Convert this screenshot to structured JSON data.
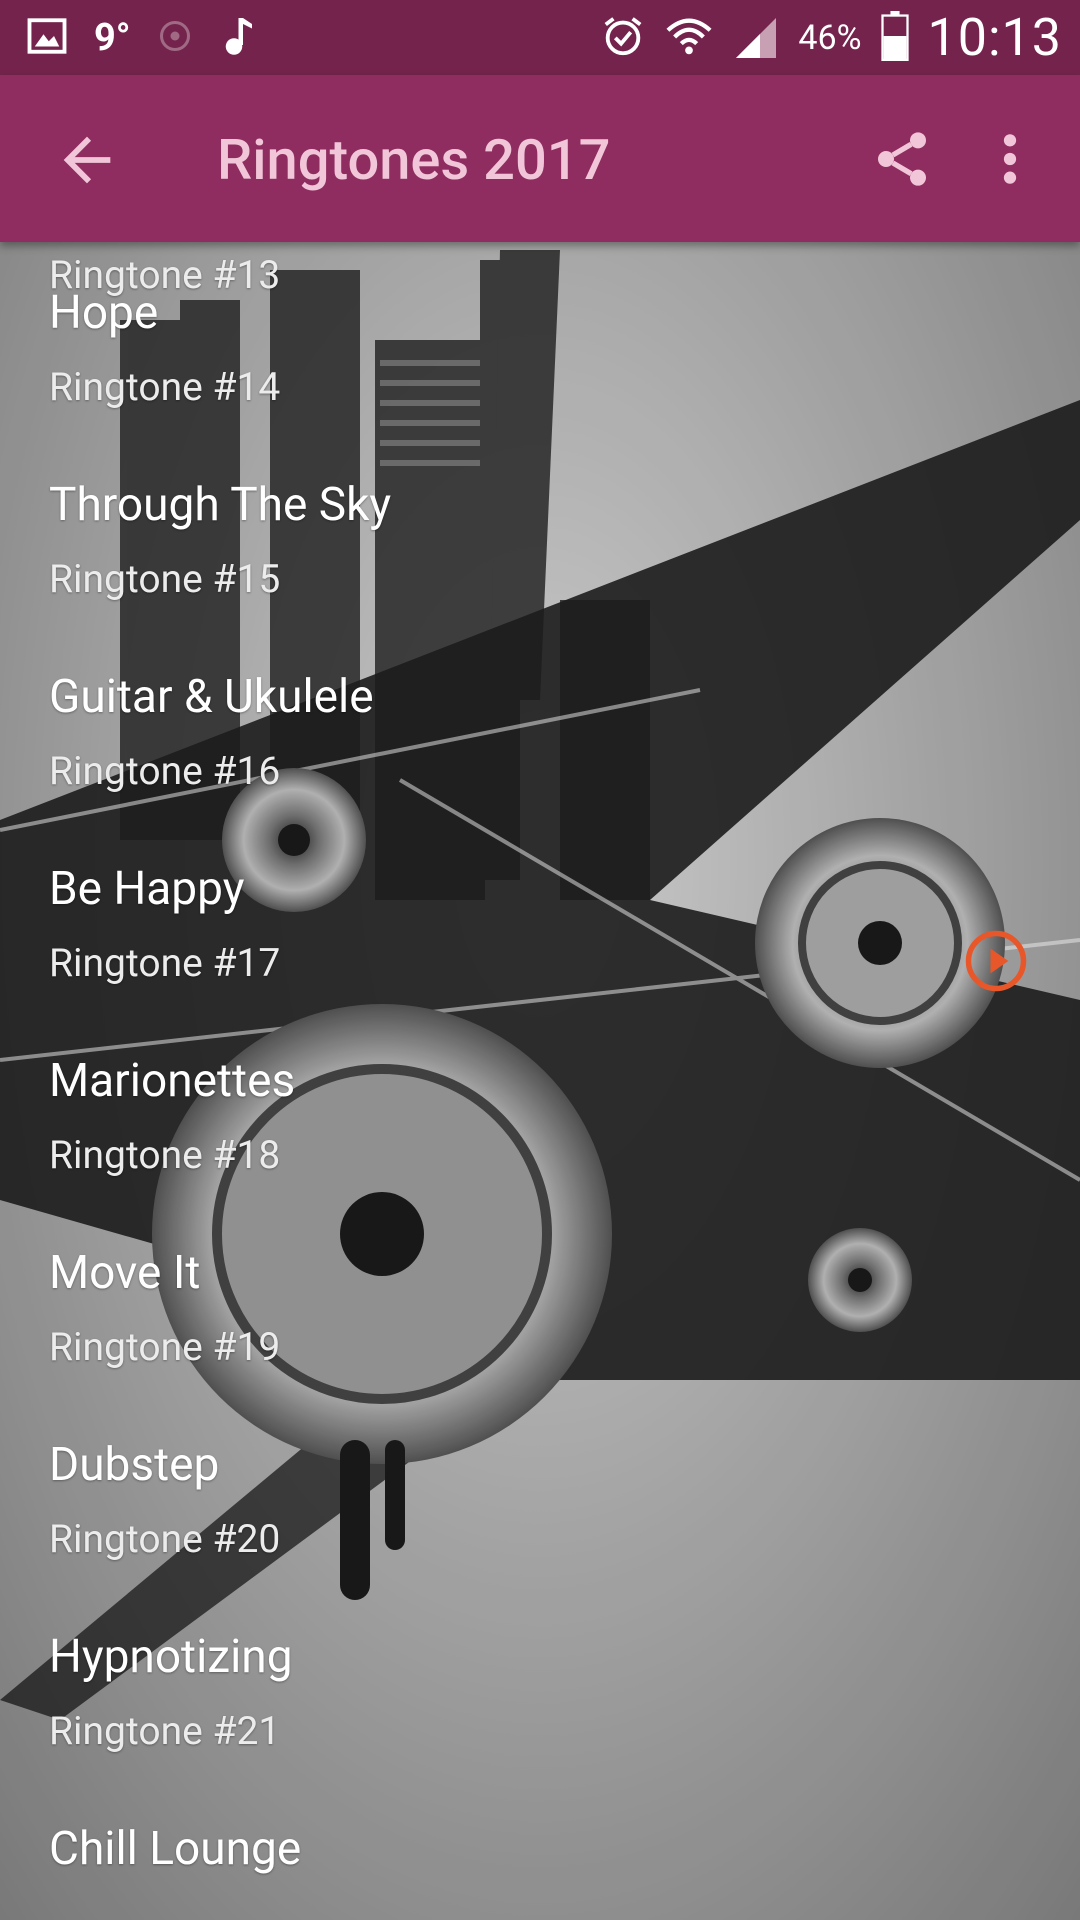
{
  "status_bar": {
    "temperature": "9°",
    "battery_percent": "46%",
    "time": "10:13",
    "icons": [
      "gallery-icon",
      "location-icon",
      "music-note-icon",
      "alarm-icon",
      "wifi-icon",
      "signal-icon",
      "battery-icon"
    ]
  },
  "app_bar": {
    "title": "Ringtones 2017",
    "back_icon": "arrow-left-icon",
    "share_icon": "share-icon",
    "menu_icon": "more-vert-icon"
  },
  "colors": {
    "status_bar": "#74244c",
    "app_bar": "#8f2c60",
    "title_text": "#f1c6d8",
    "play_accent": "#e8572a"
  },
  "ringtones": [
    {
      "name": "Hope",
      "subtitle": "Ringtone #14"
    },
    {
      "name": "Through The Sky",
      "subtitle": "Ringtone #15"
    },
    {
      "name": "Guitar & Ukulele",
      "subtitle": "Ringtone #16"
    },
    {
      "name": "Be Happy",
      "subtitle": "Ringtone #17"
    },
    {
      "name": "Marionettes",
      "subtitle": "Ringtone #18"
    },
    {
      "name": "Move It",
      "subtitle": "Ringtone #19"
    },
    {
      "name": "Dubstep",
      "subtitle": "Ringtone #20"
    },
    {
      "name": "Hypnotizing",
      "subtitle": "Ringtone #21"
    },
    {
      "name": "Chill Lounge",
      "subtitle": ""
    }
  ],
  "partial_top_item": {
    "subtitle": "Ringtone #13"
  }
}
